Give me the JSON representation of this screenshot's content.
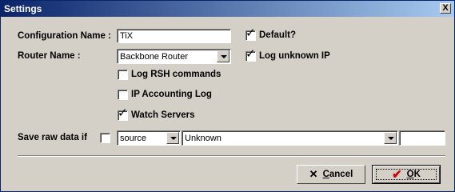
{
  "window": {
    "title": "Settings",
    "close_label": "X"
  },
  "form": {
    "config_name_label": "Configuration Name :",
    "config_name_value": "TiX",
    "router_name_label": "Router Name :",
    "router_name_value": "Backbone Router",
    "default_label": "Default?",
    "default_checked": true,
    "log_unknown_ip_label": "Log unknown IP",
    "log_unknown_ip_checked": true,
    "log_rsh_label": "Log RSH commands",
    "log_rsh_checked": false,
    "ip_accounting_label": "IP Accounting Log",
    "ip_accounting_checked": false,
    "watch_servers_label": "Watch Servers",
    "watch_servers_checked": true,
    "save_raw_label": "Save raw data if",
    "save_raw_checked": false,
    "save_raw_field_value": "source",
    "save_raw_condition_value": "Unknown",
    "save_raw_extra_value": ""
  },
  "buttons": {
    "cancel_prefix": "",
    "cancel_underline": "C",
    "cancel_rest": "ancel",
    "ok_underline": "O",
    "ok_rest": "K"
  },
  "icons": {
    "cancel": "x-icon",
    "ok": "checkmark-icon",
    "checkbox_mark": "check-icon"
  },
  "colors": {
    "titlebar_start": "#0a246a",
    "titlebar_end": "#a6caf0",
    "ok_check": "#cc0000"
  }
}
